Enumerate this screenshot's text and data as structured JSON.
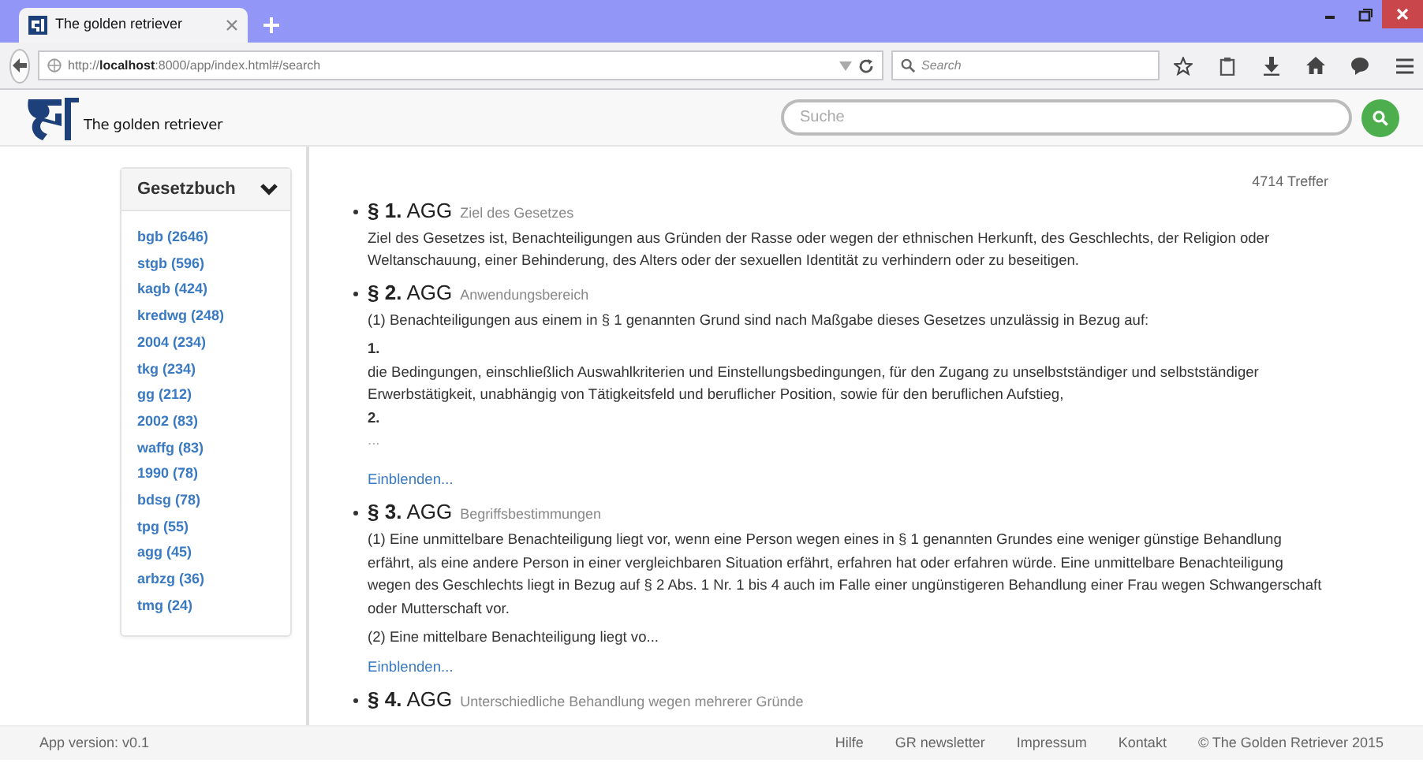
{
  "browser": {
    "tab_title": "The golden retriever",
    "url": "http://**localhost**:8000/app/index.html#/search",
    "search_placeholder": "Search"
  },
  "header": {
    "brand": "The golden retriever",
    "search_placeholder": "Suche"
  },
  "sidebar": {
    "title": "Gesetzbuch",
    "expanded": true,
    "items": [
      {
        "label": "bgb (2646)"
      },
      {
        "label": "stgb (596)"
      },
      {
        "label": "kagb (424)"
      },
      {
        "label": "kredwg (248)"
      },
      {
        "label": "2004 (234)"
      },
      {
        "label": "tkg (234)"
      },
      {
        "label": "gg (212)"
      },
      {
        "label": "2002 (83)"
      },
      {
        "label": "waffg (83)"
      },
      {
        "label": "1990 (78)"
      },
      {
        "label": "bdsg (78)"
      },
      {
        "label": "tpg (55)"
      },
      {
        "label": "agg (45)"
      },
      {
        "label": "arbzg (36)"
      },
      {
        "label": "tmg (24)"
      }
    ]
  },
  "hits": "4714 Treffer",
  "results": [
    {
      "number": "§ 1.",
      "law": "AGG",
      "title": "Ziel des Gesetzes",
      "blocks": [
        {
          "kind": "para",
          "text": "Ziel des Gesetzes ist, Benachteiligungen aus Gründen der Rasse oder wegen der ethnischen Herkunft, des Geschlechts, der Religion oder Weltanschauung, einer Behinderung, des Alters oder der sexuellen Identität zu verhindern oder zu beseitigen."
        }
      ]
    },
    {
      "number": "§ 2.",
      "law": "AGG",
      "title": "Anwendungsbereich",
      "more": "Einblenden...",
      "blocks": [
        {
          "kind": "para",
          "text": "(1) Benachteiligungen aus einem in § 1 genannten Grund sind nach Maßgabe dieses Gesetzes unzulässig in Bezug auf:"
        },
        {
          "kind": "num",
          "text": "1."
        },
        {
          "kind": "text",
          "text": "die Bedingungen, einschließlich Auswahlkriterien und Einstellungsbedingungen, für den Zugang zu unselbstständiger und selbstständiger Erwerbstätigkeit, unabhängig von Tätigkeitsfeld und beruflicher Position, sowie für den beruflichen Aufstieg,"
        },
        {
          "kind": "num",
          "text": "2."
        },
        {
          "kind": "ellipsis",
          "text": "..."
        }
      ]
    },
    {
      "number": "§ 3.",
      "law": "AGG",
      "title": "Begriffsbestimmungen",
      "more": "Einblenden...",
      "blocks": [
        {
          "kind": "para",
          "text": "(1) Eine unmittelbare Benachteiligung liegt vor, wenn eine Person wegen eines in § 1 genannten Grundes eine weniger günstige Behandlung erfährt, als eine andere Person in einer vergleichbaren Situation erfährt, erfahren hat oder erfahren würde. Eine unmittelbare Benachteiligung wegen des Geschlechts liegt in Bezug auf § 2 Abs. 1 Nr. 1 bis 4 auch im Falle einer ungünstigeren Behandlung einer Frau wegen Schwangerschaft oder Mutterschaft vor."
        },
        {
          "kind": "para",
          "text": "(2) Eine mittelbare Benachteiligung liegt vo..."
        }
      ]
    },
    {
      "number": "§ 4.",
      "law": "AGG",
      "title": "Unterschiedliche Behandlung wegen mehrerer Gründe"
    }
  ],
  "footer": {
    "version": "App version: v0.1",
    "links": [
      "Hilfe",
      "GR newsletter",
      "Impressum",
      "Kontakt"
    ],
    "copyright": "© The Golden Retriever 2015"
  }
}
